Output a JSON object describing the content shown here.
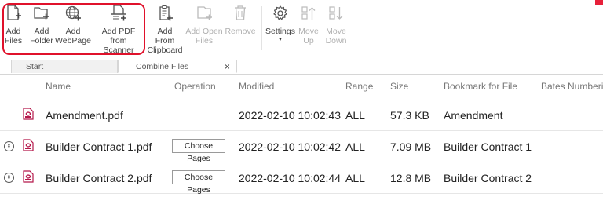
{
  "ribbon": {
    "buttons": [
      {
        "id": "add-files",
        "label": "Add\nFiles",
        "icon": "add-files-icon",
        "enabled": true
      },
      {
        "id": "add-folder",
        "label": "Add\nFolder",
        "icon": "add-folder-icon",
        "enabled": true
      },
      {
        "id": "add-webpage",
        "label": "Add\nWebPage",
        "icon": "globe-add-icon",
        "enabled": true
      },
      {
        "id": "add-pdf-scanner",
        "label": "Add PDF\nfrom Scanner",
        "icon": "scanner-add-icon",
        "enabled": true
      },
      {
        "id": "add-clipboard",
        "label": "Add From\nClipboard",
        "icon": "clipboard-add-icon",
        "enabled": true
      },
      {
        "id": "add-open-files",
        "label": "Add Open\nFiles",
        "icon": "open-files-add-icon",
        "enabled": false
      },
      {
        "id": "remove",
        "label": "Remove",
        "icon": "trash-icon",
        "enabled": false
      },
      {
        "id": "settings",
        "label": "Settings",
        "icon": "gear-icon",
        "enabled": true
      },
      {
        "id": "move-up",
        "label": "Move\nUp",
        "icon": "move-up-icon",
        "enabled": false
      },
      {
        "id": "move-down",
        "label": "Move\nDown",
        "icon": "move-down-icon",
        "enabled": false
      }
    ],
    "highlight_color": "#e0112b"
  },
  "tabs": {
    "start": "Start",
    "active": "Combine Files",
    "close_symbol": "×"
  },
  "table": {
    "headers": {
      "name": "Name",
      "operation": "Operation",
      "modified": "Modified",
      "range": "Range",
      "size": "Size",
      "bookmark": "Bookmark for File",
      "bates": "Bates Numbering"
    },
    "rows": [
      {
        "name": "Amendment.pdf",
        "operation": "",
        "modified": "2022-02-10 10:02:43",
        "range": "ALL",
        "size": "57.3 KB",
        "bookmark": "Amendment",
        "expandable": false
      },
      {
        "name": "Builder Contract 1.pdf",
        "operation": "Choose Pages",
        "modified": "2022-02-10 10:02:42",
        "range": "ALL",
        "size": "7.09 MB",
        "bookmark": "Builder Contract 1",
        "expandable": true
      },
      {
        "name": "Builder Contract 2.pdf",
        "operation": "Choose Pages",
        "modified": "2022-02-10 10:02:44",
        "range": "ALL",
        "size": "12.8 MB",
        "bookmark": "Builder Contract 2",
        "expandable": true
      }
    ]
  },
  "colors": {
    "pdf_icon": "#b5174a",
    "disabled_text": "#b0b0b0"
  }
}
